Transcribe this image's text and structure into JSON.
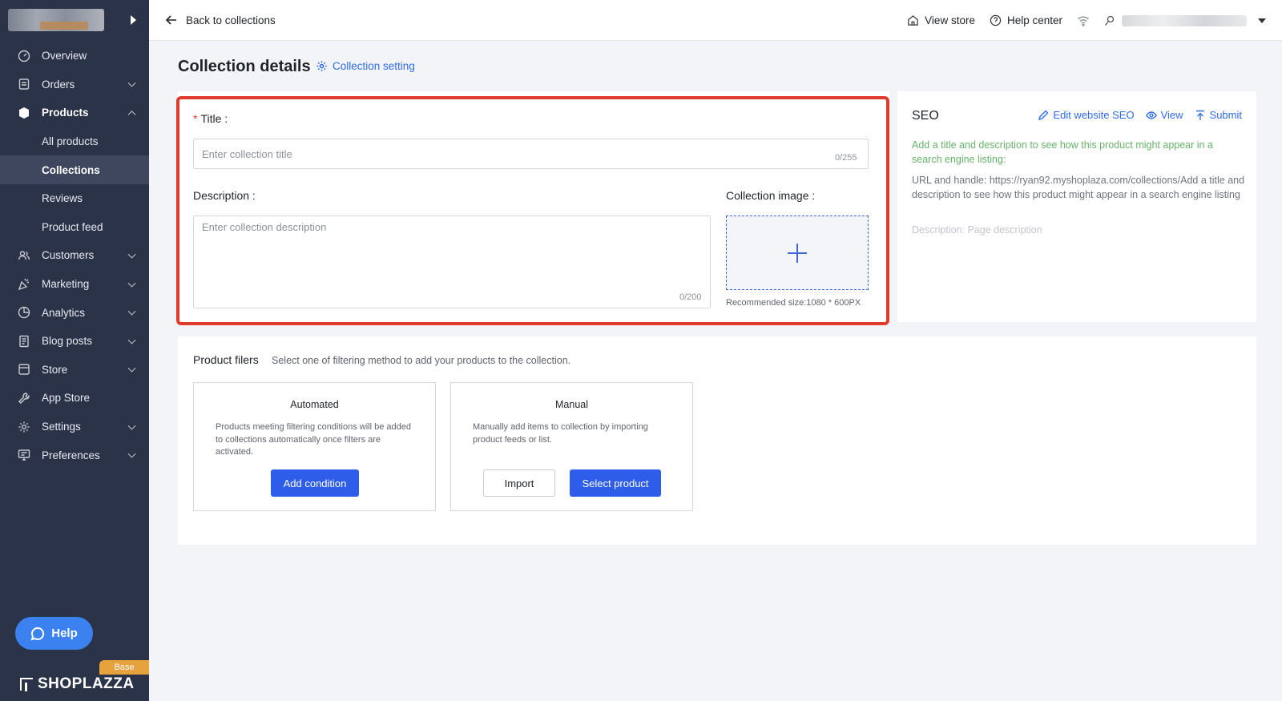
{
  "sidebar": {
    "items": [
      {
        "label": "Overview",
        "icon": "speedometer-icon"
      },
      {
        "label": "Orders",
        "icon": "orders-icon"
      },
      {
        "label": "Products",
        "icon": "box-icon"
      },
      {
        "label": "Customers",
        "icon": "users-icon"
      },
      {
        "label": "Marketing",
        "icon": "megaphone-icon"
      },
      {
        "label": "Analytics",
        "icon": "pie-chart-icon"
      },
      {
        "label": "Blog posts",
        "icon": "document-icon"
      },
      {
        "label": "Store",
        "icon": "store-icon"
      },
      {
        "label": "App Store",
        "icon": "wrench-icon"
      },
      {
        "label": "Settings",
        "icon": "gear-icon"
      },
      {
        "label": "Preferences",
        "icon": "monitor-icon"
      }
    ],
    "products_sub": [
      "All products",
      "Collections",
      "Reviews",
      "Product feed"
    ],
    "help_label": "Help",
    "plan_badge": "Base",
    "brand": "SHOPLAZZA"
  },
  "topbar": {
    "back_label": "Back to collections",
    "view_store": "View store",
    "help_center": "Help center"
  },
  "page": {
    "title": "Collection details",
    "setting_link": "Collection setting"
  },
  "form": {
    "title_label": "Title",
    "title_placeholder": "Enter collection title",
    "title_counter": "0/255",
    "description_label": "Description",
    "description_placeholder": "Enter collection description",
    "description_counter": "0/200",
    "image_label": "Collection image",
    "image_hint": "Recommended size:1080 * 600PX"
  },
  "seo": {
    "title": "SEO",
    "edit_label": "Edit website SEO",
    "view_label": "View",
    "submit_label": "Submit",
    "hint": "Add a title and description to see how this product might appear in a search engine listing:",
    "url_text": "URL and handle: https://ryan92.myshoplaza.com/collections/Add a title and description to see how this product might appear in a search engine listing",
    "description_text": "Description: Page description"
  },
  "filters": {
    "title": "Product filers",
    "subtitle": "Select one of filtering method to add your products to the collection.",
    "automated": {
      "title": "Automated",
      "text": "Products meeting filtering conditions will be added to collections automatically once filters are activated.",
      "button": "Add condition"
    },
    "manual": {
      "title": "Manual",
      "text": "Manually add items to collection by importing product feeds or list.",
      "import_button": "Import",
      "select_button": "Select product"
    }
  },
  "colors": {
    "sidebar_bg": "#2b3349",
    "accent": "#2e5ee9",
    "highlight": "#e03a2f"
  }
}
